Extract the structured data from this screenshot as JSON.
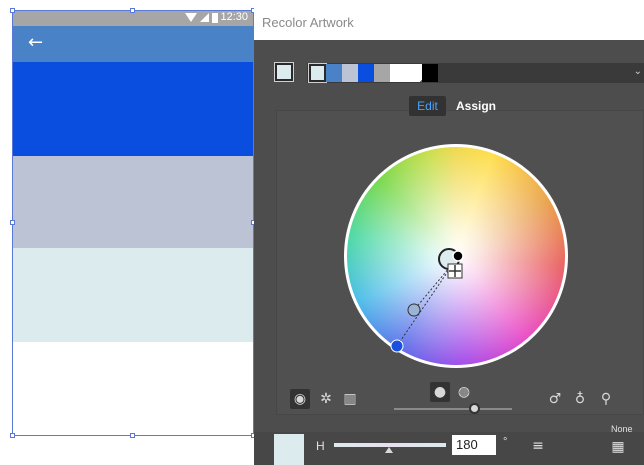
{
  "phone": {
    "status_time": "12:30",
    "back_icon": "arrow-left-icon",
    "colors": {
      "status_bar": "#a6a6a6",
      "app_bar": "#4a82c8",
      "band_blue": "#0a4ee0",
      "band_gray": "#bcc3d4",
      "band_light": "#dcebed",
      "band_white": "#ffffff"
    }
  },
  "dialog": {
    "title": "Recolor Artwork",
    "current_color": "#dcebed",
    "harmony_colors": [
      "#dcebed",
      "#4a82c8",
      "#bcc3d4",
      "#0a4ee0",
      "#a6a6a6",
      "#ffffff",
      "#000000"
    ],
    "tabs": {
      "edit": "Edit",
      "assign": "Assign"
    },
    "active_tab": "Edit",
    "tools_left": [
      "smooth-color-wheel-icon",
      "segmented-color-wheel-icon",
      "color-bars-icon"
    ],
    "tools_center": [
      "show-saturation-brightness-icon",
      "show-hue-icon"
    ],
    "tools_right": [
      "add-color-tool-icon",
      "remove-color-tool-icon",
      "unlink-harmony-colors-icon"
    ],
    "hue": {
      "label": "H",
      "value": "180",
      "unit": "°"
    },
    "none_label": "None",
    "menu_icon": "menu-icon",
    "grid_icon": "color-group-grid-icon"
  }
}
